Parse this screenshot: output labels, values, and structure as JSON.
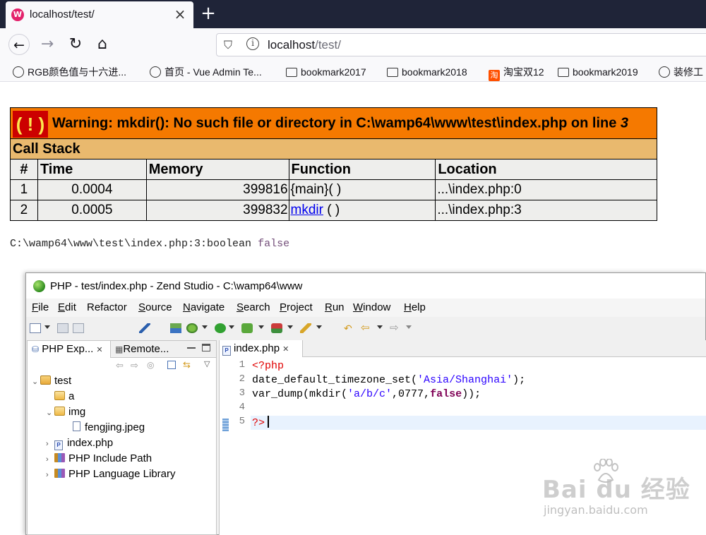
{
  "browser": {
    "tab_title": "localhost/test/",
    "favicon_text": "W",
    "url_host": "localhost",
    "url_path": "/test/",
    "bookmarks": [
      {
        "icon": "globe-icon",
        "label": "RGB颜色值与十六进..."
      },
      {
        "icon": "globe-icon",
        "label": "首页 - Vue Admin Te..."
      },
      {
        "icon": "folder-icon",
        "label": "bookmark2017"
      },
      {
        "icon": "folder-icon",
        "label": "bookmark2018"
      },
      {
        "icon": "taobao-icon",
        "label": "淘宝双12"
      },
      {
        "icon": "folder-icon",
        "label": "bookmark2019"
      },
      {
        "icon": "globe-icon",
        "label": "装修工"
      }
    ],
    "taobao_icon_text": "淘"
  },
  "xdebug": {
    "warning_icon": "( ! )",
    "warning_text": "Warning: mkdir(): No such file or directory in C:\\wamp64\\www\\test\\index.php on line ",
    "warning_line": "3",
    "callstack_title": "Call Stack",
    "headers": [
      "#",
      "Time",
      "Memory",
      "Function",
      "Location"
    ],
    "rows": [
      {
        "idx": "1",
        "time": "0.0004",
        "memory": "399816",
        "function": "{main}( )",
        "function_link": "",
        "function_suffix": "",
        "location": "...\\index.php:0"
      },
      {
        "idx": "2",
        "time": "0.0005",
        "memory": "399832",
        "function": "",
        "function_link": "mkdir",
        "function_suffix": " ( )",
        "location": "...\\index.php:3"
      }
    ],
    "vardump_prefix": "C:\\wamp64\\www\\test\\index.php:3:boolean ",
    "vardump_value": "false"
  },
  "zend": {
    "window_title": "PHP - test/index.php - Zend Studio - C:\\wamp64\\www",
    "menu": [
      {
        "u": "F",
        "rest": "ile"
      },
      {
        "u": "E",
        "rest": "dit"
      },
      {
        "u": "",
        "rest": "Refactor"
      },
      {
        "u": "S",
        "rest": "ource"
      },
      {
        "u": "N",
        "rest": "avigate"
      },
      {
        "u": "S",
        "rest": "earch"
      },
      {
        "u": "P",
        "rest": "roject"
      },
      {
        "u": "R",
        "rest": "un"
      },
      {
        "u": "W",
        "rest": "indow"
      },
      {
        "u": "H",
        "rest": "elp"
      }
    ],
    "explorer": {
      "tab1": "PHP Exp...",
      "tab2": "Remote...",
      "tree": [
        {
          "label": "test",
          "twisty": "⌄",
          "icon": "project"
        },
        {
          "label": "a",
          "twisty": "",
          "icon": "folder"
        },
        {
          "label": "img",
          "twisty": "⌄",
          "icon": "folder"
        },
        {
          "label": "fengjing.jpeg",
          "twisty": "",
          "icon": "file"
        },
        {
          "label": "index.php",
          "twisty": "›",
          "icon": "php"
        },
        {
          "label": "PHP Include Path",
          "twisty": "›",
          "icon": "library"
        },
        {
          "label": "PHP Language Library",
          "twisty": "›",
          "icon": "library"
        }
      ]
    },
    "editor": {
      "tab": "index.php",
      "php_file_icon": "P",
      "line_numbers": [
        "1",
        "2",
        "3",
        "4",
        "5"
      ],
      "lines": {
        "l1": "<?php",
        "l2_a": "date_default_timezone_set(",
        "l2_s": "'Asia/Shanghai'",
        "l2_b": ");",
        "l3_a": "var_dump(mkdir(",
        "l3_s": "'a/b/c'",
        "l3_b": ",0777,",
        "l3_k": "false",
        "l3_c": "));",
        "l4": "",
        "l5": "?>"
      }
    }
  },
  "watermark": {
    "main": "Bai  du 经验",
    "sub": "jingyan.baidu.com"
  }
}
